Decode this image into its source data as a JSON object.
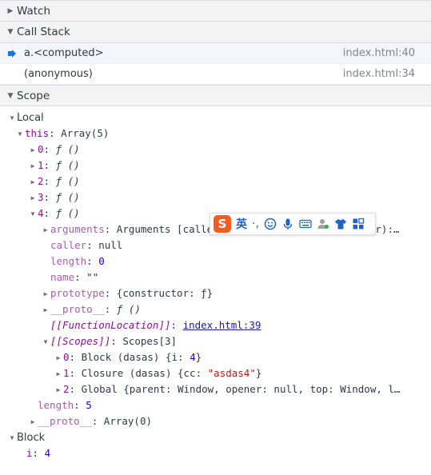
{
  "sections": {
    "watch": {
      "title": "Watch"
    },
    "call_stack": {
      "title": "Call Stack",
      "frames": [
        {
          "name": "a.<computed>",
          "location": "index.html:40"
        },
        {
          "name": "(anonymous)",
          "location": "index.html:34"
        }
      ]
    },
    "scope": {
      "title": "Scope"
    }
  },
  "scope_tree": {
    "local_label": "Local",
    "this_key": "this",
    "this_val": "Array(5)",
    "items": [
      {
        "key": "0",
        "val": "ƒ ()"
      },
      {
        "key": "1",
        "val": "ƒ ()"
      },
      {
        "key": "2",
        "val": "ƒ ()"
      },
      {
        "key": "3",
        "val": "ƒ ()"
      },
      {
        "key": "4",
        "val": "ƒ ()"
      }
    ],
    "fn_props": {
      "arguments_key": "arguments",
      "arguments_val": "Arguments [callee: ƒ, Symbol(Symbol.iterator):…",
      "caller_key": "caller",
      "caller_val": "null",
      "length_key": "length",
      "length_val": "0",
      "name_key": "name",
      "name_val": "\"\"",
      "prototype_key": "prototype",
      "prototype_val": "{constructor: ƒ}",
      "proto_key": "__proto__",
      "proto_val": "ƒ ()",
      "fnloc_key": "[[FunctionLocation]]",
      "fnloc_val": "index.html:39",
      "scopes_key": "[[Scopes]]",
      "scopes_val": "Scopes[3]",
      "scopes": [
        {
          "key": "0",
          "val": "Block (dasas) {i: ",
          "num": "4",
          "tail": "}"
        },
        {
          "key": "1",
          "val": "Closure (dasas) {cc: ",
          "str": "\"asdas4\"",
          "tail": "}"
        },
        {
          "key": "2",
          "val": "Global {parent: Window, opener: null, top: Window, l…"
        }
      ]
    },
    "array_length_key": "length",
    "array_length_val": "5",
    "array_proto_key": "__proto__",
    "array_proto_val": "Array(0)",
    "block_label": "Block",
    "block_i_key": "i",
    "block_i_val": "4"
  },
  "ime_toolbar": {
    "logo": "S",
    "lang": "英",
    "punct": "·,"
  }
}
